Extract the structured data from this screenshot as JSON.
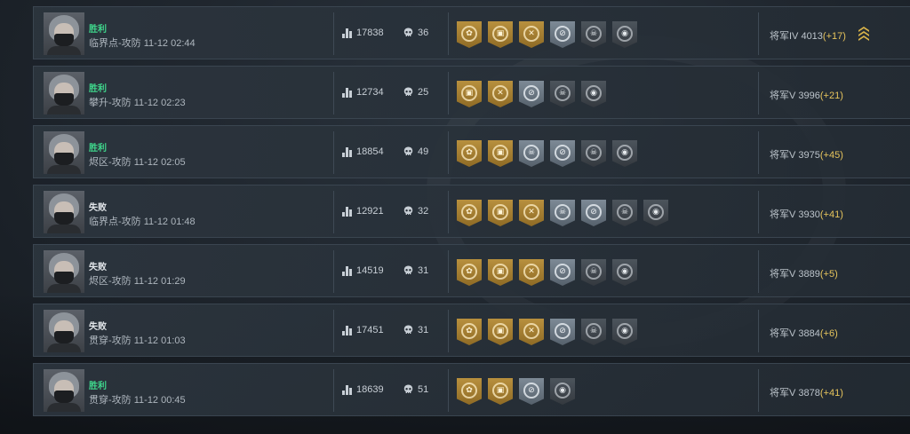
{
  "matches": [
    {
      "result": "胜利",
      "win": true,
      "map": "临界点-攻防",
      "time": "11-12 02:44",
      "score": "17838",
      "kills": "36",
      "rank": "将军IV 4013",
      "delta": "(+17)",
      "rank_badge": true,
      "medals": [
        {
          "tier": "gold",
          "icon": "flower-icon"
        },
        {
          "tier": "gold",
          "icon": "box-icon"
        },
        {
          "tier": "gold",
          "icon": "axes-icon"
        },
        {
          "tier": "silver",
          "icon": "crosshair-icon"
        },
        {
          "tier": "dark",
          "icon": "skull-icon"
        },
        {
          "tier": "dark",
          "icon": "eye-icon"
        }
      ]
    },
    {
      "result": "胜利",
      "win": true,
      "map": "攀升-攻防",
      "time": "11-12 02:23",
      "score": "12734",
      "kills": "25",
      "rank": "将军V 3996",
      "delta": "(+21)",
      "rank_badge": false,
      "medals": [
        {
          "tier": "gold",
          "icon": "box-icon"
        },
        {
          "tier": "gold",
          "icon": "axes-icon"
        },
        {
          "tier": "silver",
          "icon": "crosshair-icon"
        },
        {
          "tier": "dark",
          "icon": "skull-icon"
        },
        {
          "tier": "dark",
          "icon": "eye-icon"
        }
      ]
    },
    {
      "result": "胜利",
      "win": true,
      "map": "烬区-攻防",
      "time": "11-12 02:05",
      "score": "18854",
      "kills": "49",
      "rank": "将军V 3975",
      "delta": "(+45)",
      "rank_badge": false,
      "medals": [
        {
          "tier": "gold",
          "icon": "flower-icon"
        },
        {
          "tier": "gold",
          "icon": "box-icon"
        },
        {
          "tier": "silver",
          "icon": "skull-icon"
        },
        {
          "tier": "silver",
          "icon": "crosshair-icon"
        },
        {
          "tier": "dark",
          "icon": "skull-icon"
        },
        {
          "tier": "dark",
          "icon": "eye-icon"
        }
      ]
    },
    {
      "result": "失败",
      "win": false,
      "map": "临界点-攻防",
      "time": "11-12 01:48",
      "score": "12921",
      "kills": "32",
      "rank": "将军V 3930",
      "delta": "(+41)",
      "rank_badge": false,
      "medals": [
        {
          "tier": "gold",
          "icon": "flower-icon"
        },
        {
          "tier": "gold",
          "icon": "box-icon"
        },
        {
          "tier": "gold",
          "icon": "axes-icon"
        },
        {
          "tier": "silver",
          "icon": "skull-icon"
        },
        {
          "tier": "silver",
          "icon": "crosshair-icon"
        },
        {
          "tier": "dark",
          "icon": "skull-icon"
        },
        {
          "tier": "dark",
          "icon": "eye-icon"
        }
      ]
    },
    {
      "result": "失败",
      "win": false,
      "map": "烬区-攻防",
      "time": "11-12 01:29",
      "score": "14519",
      "kills": "31",
      "rank": "将军V 3889",
      "delta": "(+5)",
      "rank_badge": false,
      "medals": [
        {
          "tier": "gold",
          "icon": "flower-icon"
        },
        {
          "tier": "gold",
          "icon": "box-icon"
        },
        {
          "tier": "gold",
          "icon": "axes-icon"
        },
        {
          "tier": "silver",
          "icon": "crosshair-icon"
        },
        {
          "tier": "dark",
          "icon": "skull-icon"
        },
        {
          "tier": "dark",
          "icon": "eye-icon"
        }
      ]
    },
    {
      "result": "失败",
      "win": false,
      "map": "贯穿-攻防",
      "time": "11-12 01:03",
      "score": "17451",
      "kills": "31",
      "rank": "将军V 3884",
      "delta": "(+6)",
      "rank_badge": false,
      "medals": [
        {
          "tier": "gold",
          "icon": "flower-icon"
        },
        {
          "tier": "gold",
          "icon": "box-icon"
        },
        {
          "tier": "gold",
          "icon": "axes-icon"
        },
        {
          "tier": "silver",
          "icon": "crosshair-icon"
        },
        {
          "tier": "dark",
          "icon": "skull-icon"
        },
        {
          "tier": "dark",
          "icon": "eye-icon"
        }
      ]
    },
    {
      "result": "胜利",
      "win": true,
      "map": "贯穿-攻防",
      "time": "11-12 00:45",
      "score": "18639",
      "kills": "51",
      "rank": "将军V 3878",
      "delta": "(+41)",
      "rank_badge": false,
      "medals": [
        {
          "tier": "gold",
          "icon": "flower-icon"
        },
        {
          "tier": "gold",
          "icon": "box-icon"
        },
        {
          "tier": "silver",
          "icon": "crosshair-icon"
        },
        {
          "tier": "dark",
          "icon": "eye-icon"
        }
      ]
    }
  ],
  "colors": {
    "win": "#3fd68c",
    "loss": "#e3e7eb",
    "delta": "#e6c45c",
    "gold": "#b8903e",
    "silver": "#7d8a96"
  }
}
